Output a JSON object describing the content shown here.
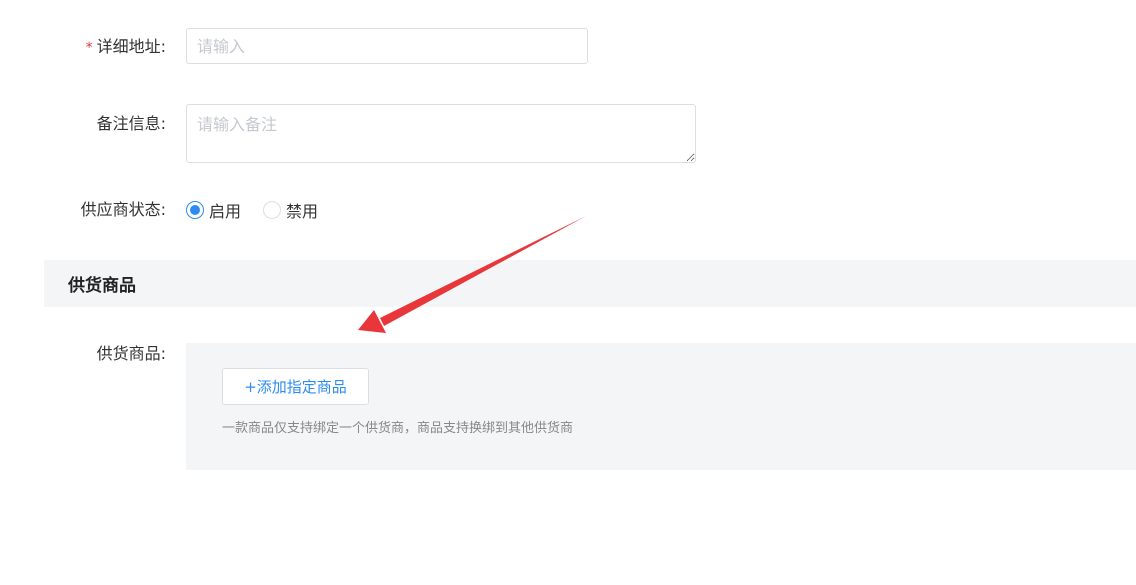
{
  "form": {
    "address": {
      "required_mark": "*",
      "label": "详细地址:",
      "value": "",
      "placeholder": "请输入"
    },
    "remark": {
      "label": "备注信息:",
      "value": "",
      "placeholder": "请输入备注"
    },
    "status": {
      "label": "供应商状态:",
      "options": [
        {
          "label": "启用",
          "checked": true
        },
        {
          "label": "禁用",
          "checked": false
        }
      ]
    }
  },
  "goods_section": {
    "title": "供货商品",
    "label": "供货商品:",
    "add_button_label": "+添加指定商品",
    "hint": "一款商品仅支持绑定一个供货商，商品支持换绑到其他供货商"
  },
  "colors": {
    "accent": "#2d8cf0",
    "required": "#e4393c",
    "annotation_arrow": "#e8363a",
    "panel_bg": "#f4f5f7"
  }
}
